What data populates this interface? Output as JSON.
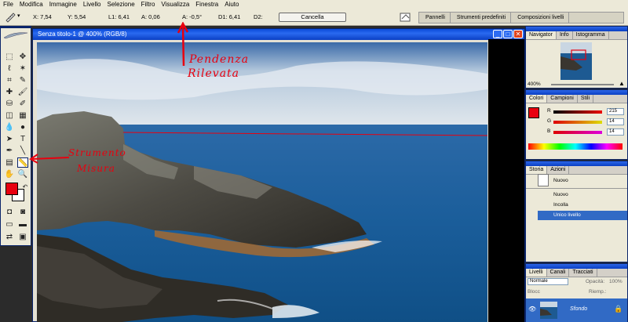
{
  "menu": [
    "File",
    "Modifica",
    "Immagine",
    "Livello",
    "Selezione",
    "Filtro",
    "Visualizza",
    "Finestra",
    "Aiuto"
  ],
  "options": {
    "x": "X: 7,54",
    "y": "Y: 5,54",
    "l1": "L1: 6,41",
    "a": "A: 0,06",
    "angle": "A: -0,5°",
    "d1": "D1: 6,41",
    "d2": "D2:",
    "cancel": "Cancella"
  },
  "well_tabs": [
    "Pannelli",
    "Strumenti predefiniti",
    "Composizioni livelli"
  ],
  "document": {
    "title": "Senza titolo-1 @ 400% (RGB/8)"
  },
  "annotations": {
    "slope": [
      "Pendenza",
      "Rilevata"
    ],
    "tool": [
      "Strumento",
      "Misura"
    ]
  },
  "navigator": {
    "tabs": [
      "Navigator",
      "Info",
      "Istogramma"
    ],
    "zoom": "400%"
  },
  "colors": {
    "tabs": [
      "Colori",
      "Campioni",
      "Stili"
    ],
    "channels": [
      {
        "label": "R",
        "value": "215",
        "color": "#d70e0e"
      },
      {
        "label": "G",
        "value": "14",
        "color": "#0ed70e"
      },
      {
        "label": "B",
        "value": "14",
        "color": "#0e0ed7"
      }
    ]
  },
  "history": {
    "tabs": [
      "Storia",
      "Azioni"
    ],
    "snapshot": "Nuovo",
    "items": [
      "Nuovo",
      "Incolla",
      "Unico livello"
    ]
  },
  "layers": {
    "tabs": [
      "Livelli",
      "Canali",
      "Tracciati"
    ],
    "blend_mode": "Normale",
    "opacity_label": "Opacità:",
    "opacity_value": "100%",
    "lock_label": "Blocc",
    "fill_label": "Riemp.:",
    "layer_name": "Sfondo"
  },
  "palette": {
    "accent": "#0a246a",
    "selection": "#316ac5",
    "foreground": "#e8000f"
  }
}
